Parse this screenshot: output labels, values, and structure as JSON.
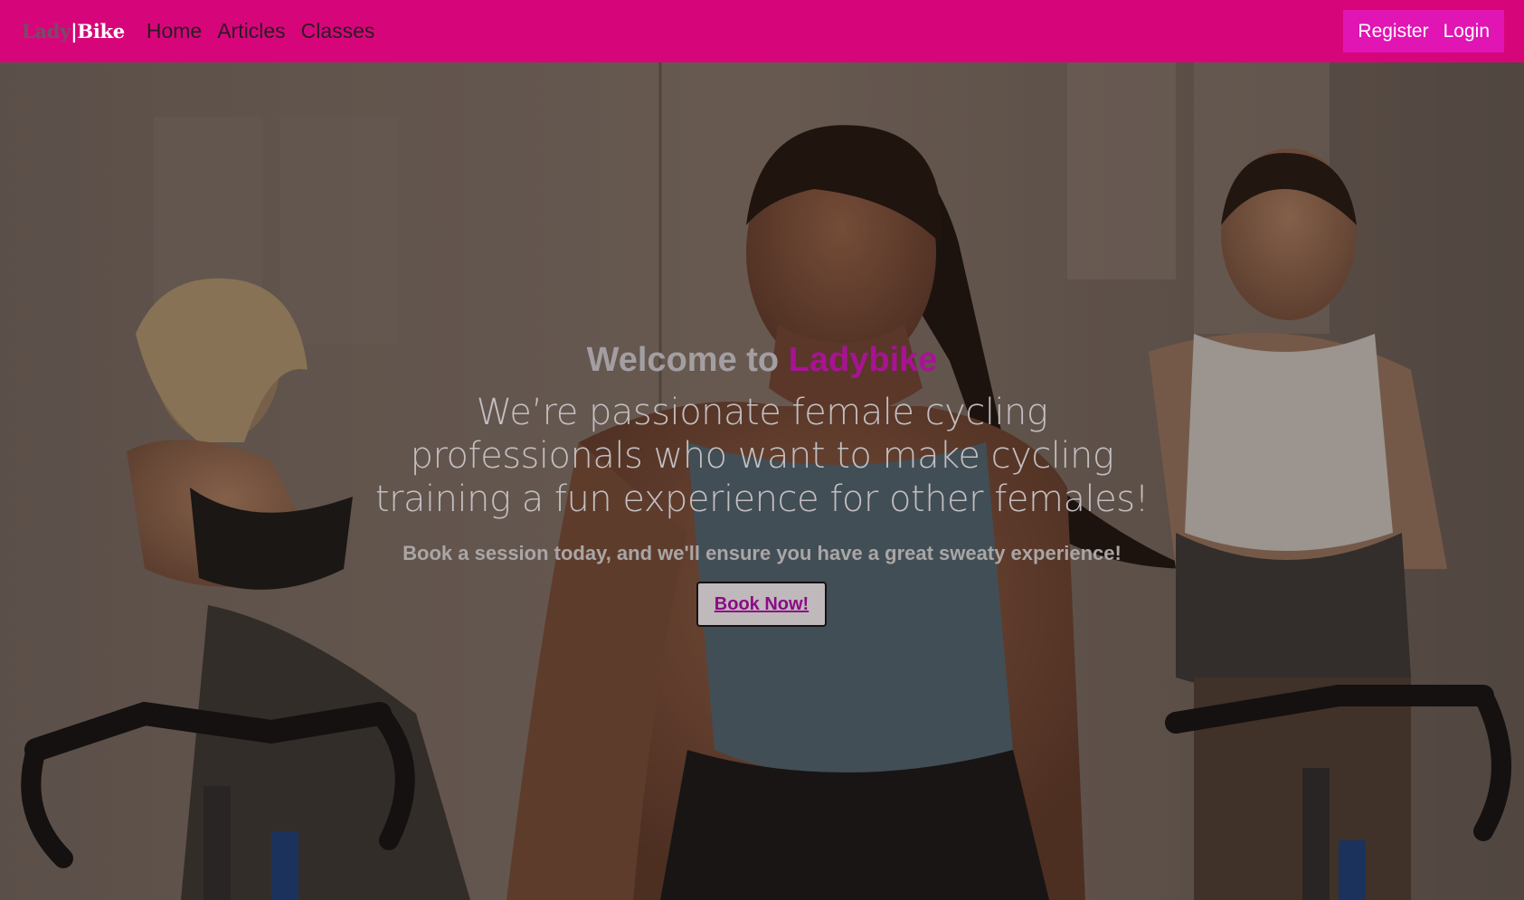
{
  "navbar": {
    "brand_part1": "Lady",
    "brand_sep": "|",
    "brand_part2": "Bike",
    "links": [
      "Home",
      "Articles",
      "Classes"
    ],
    "register_label": "Register",
    "login_label": "Login",
    "bg_color": "#d6067a",
    "auth_bg_color": "#e114b4"
  },
  "hero": {
    "welcome_prefix": "Welcome to ",
    "welcome_brand": "Ladybike",
    "tagline": "We’re passionate female cycling professionals who want to make cycling training a fun experience for other females!",
    "cta_text": "Book a session today, and we'll ensure you have a great sweaty experience!",
    "button_label": "Book Now!",
    "accent_color": "#a81394"
  }
}
